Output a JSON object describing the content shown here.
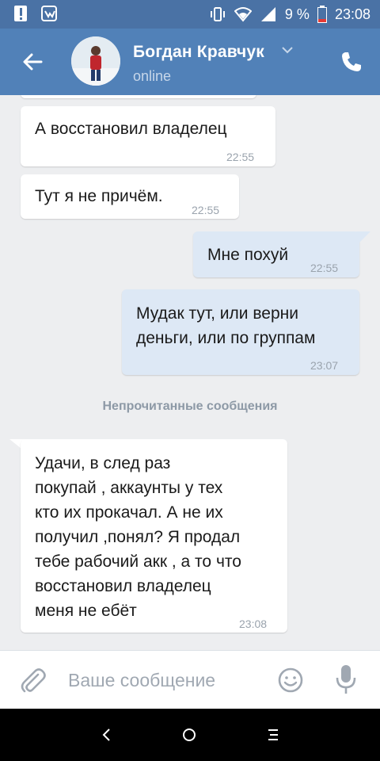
{
  "status_bar": {
    "icons": [
      "alert-icon",
      "vk-notification-icon",
      "vibrate-icon",
      "wifi-icon",
      "signal-icon",
      "battery-icon"
    ],
    "battery": "9 %",
    "time": "23:08"
  },
  "header": {
    "name": "Богдан Кравчук",
    "status": "online"
  },
  "messages": [
    {
      "direction": "in",
      "text": "А восстановил владелец",
      "time": "22:55"
    },
    {
      "direction": "in",
      "text": "Тут я не причём.",
      "time": "22:55"
    },
    {
      "direction": "out",
      "text": "Мне похуй",
      "time": "22:55"
    },
    {
      "direction": "out",
      "lines": [
        "Мудак тут, или верни",
        "деньги, или по группам"
      ],
      "time": "23:07"
    },
    {
      "direction": "in",
      "lines": [
        "Удачи, в след раз",
        "покупай , аккаунты у тех",
        "кто их прокачал. А не их",
        "получил ,понял? Я продал",
        "тебе рабочий акк , а то что",
        "восстановил владелец",
        "меня не ебёт"
      ],
      "time": "23:08"
    }
  ],
  "unread_label": "Непрочитанные сообщения",
  "composer": {
    "placeholder": "Ваше сообщение"
  },
  "colors": {
    "header": "#5181b8",
    "status_bar": "#4a72a5",
    "incoming_bubble": "#ffffff",
    "outgoing_bubble": "#dde8f5",
    "background": "#edeef0"
  }
}
